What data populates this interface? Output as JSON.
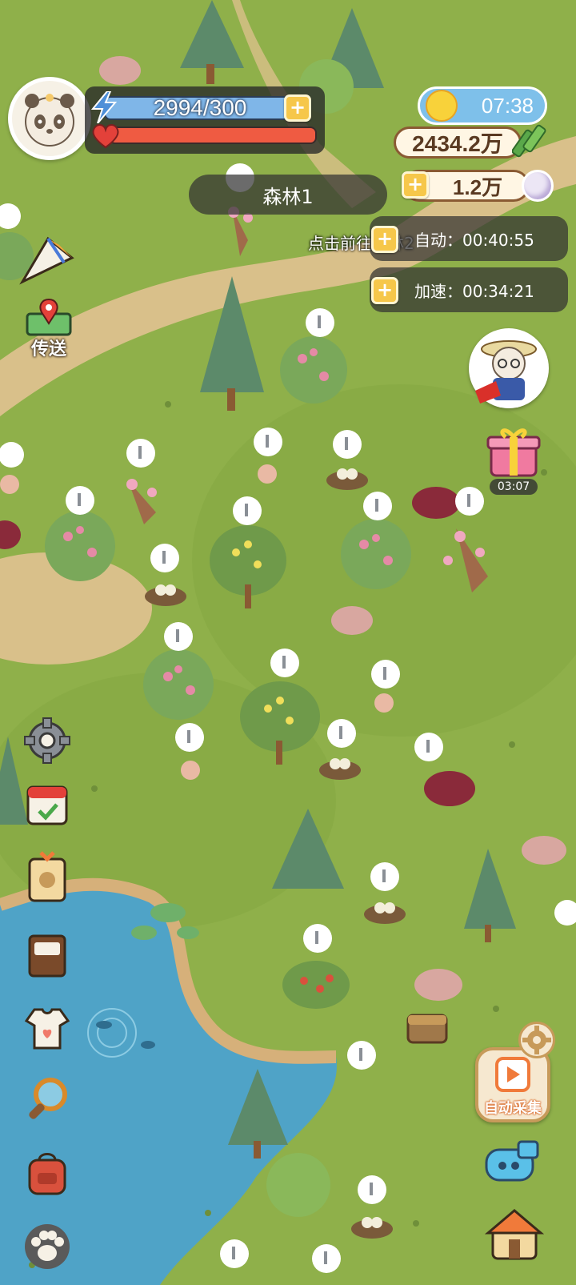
{
  "hud": {
    "energy": "2994/300",
    "gold": "2434.2万",
    "pearls": "1.2万",
    "clock": "07:38",
    "plus_symbol": "+"
  },
  "zone": {
    "name": "森林1"
  },
  "hint_text": "点击前往森林2",
  "timers": {
    "auto_label": "自动：00:40:55",
    "speed_label": "加速：00:34:21"
  },
  "left_menu": {
    "teleport_label": "传送"
  },
  "gift": {
    "countdown": "03:07"
  },
  "auto_collect": {
    "label": "自动采集"
  },
  "colors": {
    "grass": "#8fb04a",
    "path": "#d9c08a",
    "water": "#4fa3c7",
    "energy": "#7fb6e8",
    "health": "#ef5b42"
  },
  "icons": [
    "lightning-icon",
    "heart-icon",
    "bamboo-icon",
    "pearl-icon",
    "sun-icon",
    "map-pin-icon",
    "gear-icon",
    "calendar-icon",
    "bag-icon",
    "book-icon",
    "shirt-icon",
    "magnifier-icon",
    "backpack-icon",
    "paw-icon",
    "play-icon",
    "whistle-icon",
    "house-icon",
    "gift-icon",
    "axe-icon",
    "treasure-chest-icon"
  ]
}
